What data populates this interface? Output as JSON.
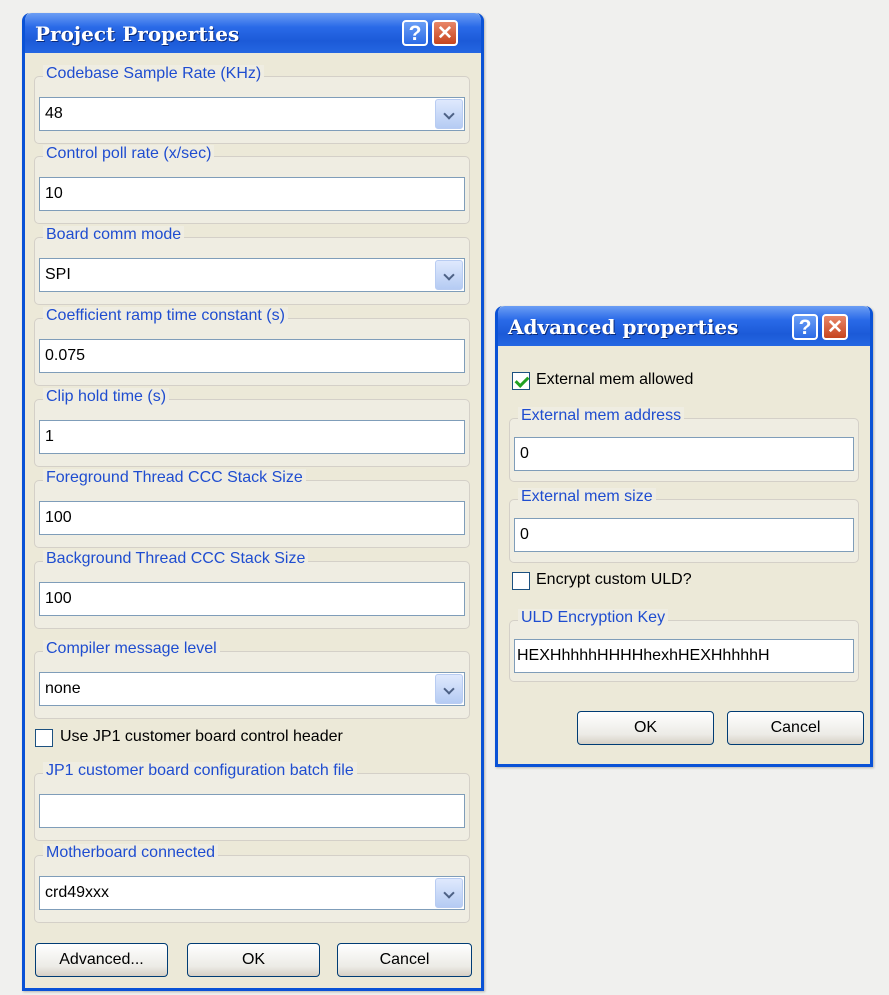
{
  "project_dialog": {
    "title": "Project Properties",
    "help_glyph": "?",
    "close_glyph": "✕",
    "sample_rate": {
      "label": "Codebase Sample Rate (KHz)",
      "value": "48"
    },
    "poll_rate": {
      "label": "Control poll rate (x/sec)",
      "value": "10"
    },
    "comm_mode": {
      "label": "Board comm mode",
      "value": "SPI"
    },
    "ramp_time": {
      "label": "Coefficient ramp time constant (s)",
      "value": "0.075"
    },
    "clip_hold": {
      "label": "Clip hold time (s)",
      "value": "1"
    },
    "fg_stack": {
      "label": "Foreground Thread CCC Stack Size",
      "value": "100"
    },
    "bg_stack": {
      "label": "Background Thread CCC Stack Size",
      "value": "100"
    },
    "msg_level": {
      "label": "Compiler message level",
      "value": "none"
    },
    "jp1_header": {
      "label": "Use JP1 customer board control header",
      "checked": false
    },
    "jp1_batch": {
      "label": "JP1 customer board configuration batch file",
      "value": ""
    },
    "motherboard": {
      "label": "Motherboard connected",
      "value": "crd49xxx"
    },
    "buttons": {
      "advanced": "Advanced...",
      "ok": "OK",
      "cancel": "Cancel"
    }
  },
  "advanced_dialog": {
    "title": "Advanced properties",
    "help_glyph": "?",
    "close_glyph": "✕",
    "ext_mem_allowed": {
      "label": "External mem allowed",
      "checked": true
    },
    "ext_mem_address": {
      "label": "External mem address",
      "value": "0"
    },
    "ext_mem_size": {
      "label": "External mem size",
      "value": "0"
    },
    "encrypt_uld": {
      "label": "Encrypt custom ULD?",
      "checked": false
    },
    "uld_key": {
      "label": "ULD Encryption Key",
      "value": "HEXHhhhhHHHHhexhHEXHhhhhH"
    },
    "buttons": {
      "ok": "OK",
      "cancel": "Cancel"
    }
  },
  "colors": {
    "titlebar": "#2a6ae8",
    "window_border": "#0a52d6",
    "dialog_bg": "#ece9d8",
    "group_label": "#1f4dd0",
    "close_button": "#c6451f",
    "check_mark": "#21a121"
  }
}
